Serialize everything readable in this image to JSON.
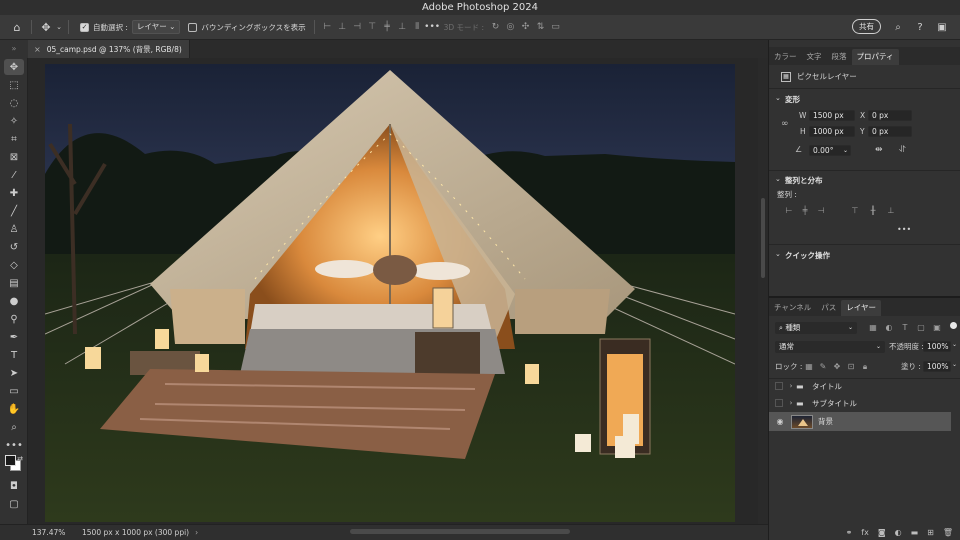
{
  "app": {
    "title": "Adobe Photoshop 2024"
  },
  "options_bar": {
    "auto_select_label": "自動選択 :",
    "auto_select_checked": true,
    "auto_select_target": "レイヤー",
    "bounding_box_label": "バウンディングボックスを表示",
    "bounding_box_checked": false,
    "mode_3d_label": "3D モード :",
    "share_label": "共有"
  },
  "document": {
    "tab_title": "05_camp.psd @ 137% (背景, RGB/8)",
    "close_symbol": "×"
  },
  "status": {
    "zoom": "137.47%",
    "info": "1500 px x 1000 px (300 ppi)",
    "arrow": "›"
  },
  "panel_top": {
    "tabs": [
      "カラー",
      "文字",
      "段落",
      "プロパティ"
    ],
    "active_tab": 3,
    "layer_kind": "ピクセルレイヤー",
    "transform": {
      "heading": "変形",
      "w_label": "W",
      "w_value": "1500 px",
      "x_label": "X",
      "x_value": "0 px",
      "h_label": "H",
      "h_value": "1000 px",
      "y_label": "Y",
      "y_value": "0 px",
      "angle_value": "0.00°"
    },
    "align": {
      "heading": "整列と分布",
      "sub_label": "整列 :",
      "more": "•••"
    },
    "quick_actions": {
      "heading": "クイック操作"
    }
  },
  "panel_layers": {
    "tabs": [
      "チャンネル",
      "パス",
      "レイヤー"
    ],
    "active_tab": 2,
    "filter_kind": "種類",
    "blend_mode": "通常",
    "opacity_label": "不透明度 :",
    "opacity_value": "100%",
    "lock_label": "ロック :",
    "fill_label": "塗り :",
    "fill_value": "100%",
    "layers": [
      {
        "name": "タイトル",
        "type": "group",
        "visible": false,
        "selected": false
      },
      {
        "name": "サブタイトル",
        "type": "group",
        "visible": false,
        "selected": false
      },
      {
        "name": "背景",
        "type": "pixel",
        "visible": true,
        "selected": true
      }
    ]
  },
  "icons": {
    "home": "home-icon",
    "move": "move-tool-icon",
    "search": "search-icon",
    "help": "help-icon",
    "workspace": "workspace-icon"
  },
  "colors": {
    "accent_selected": "#565656",
    "panel_bg": "#323232",
    "canvas_bg": "#282828"
  }
}
